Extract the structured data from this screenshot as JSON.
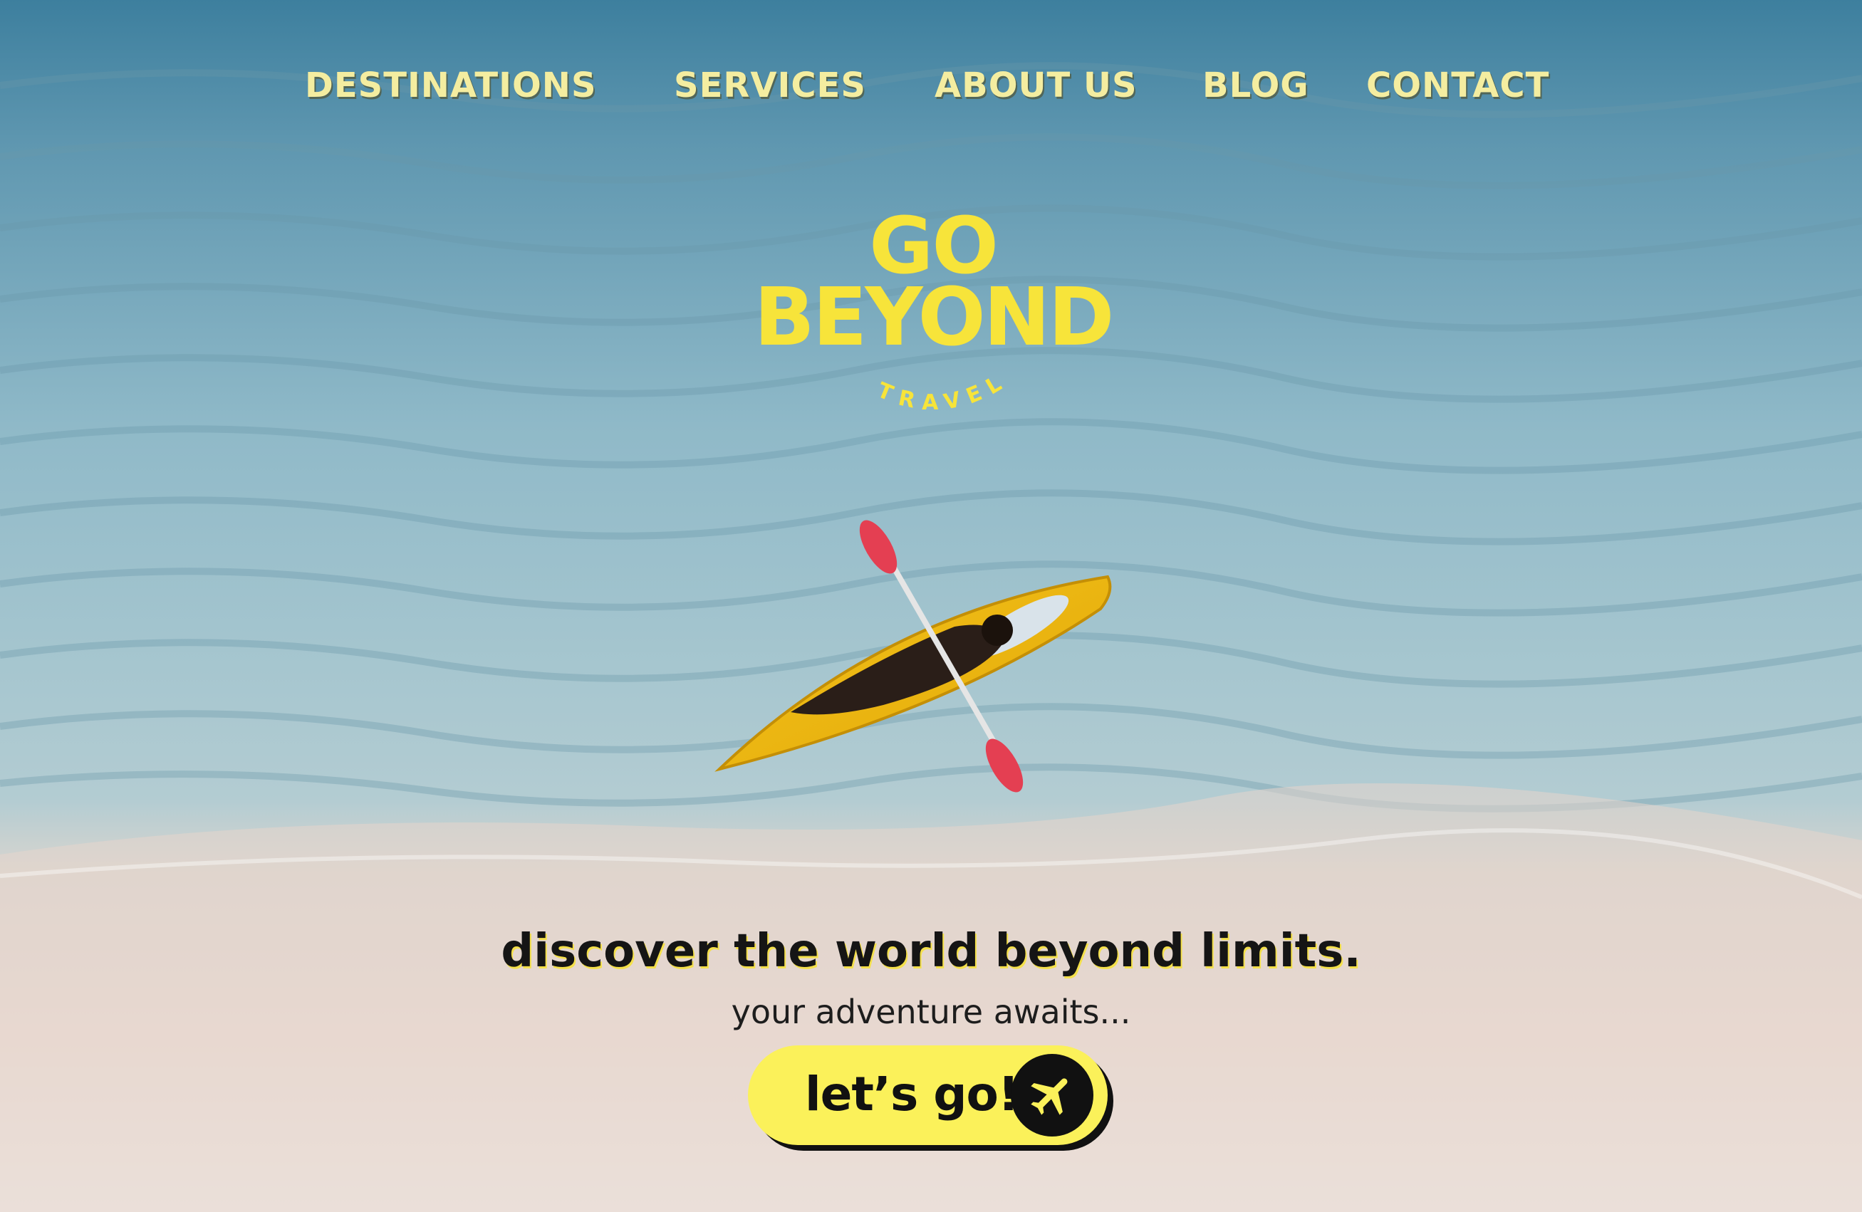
{
  "nav": {
    "items": [
      {
        "label": "DESTINATIONS"
      },
      {
        "label": "SERVICES"
      },
      {
        "label": "ABOUT US"
      },
      {
        "label": "BLOG"
      },
      {
        "label": "CONTACT"
      }
    ]
  },
  "logo": {
    "line1": "GO",
    "line2": "BEYOND",
    "tagline": "TRAVEL"
  },
  "hero": {
    "headline": "discover the world beyond limits.",
    "subheadline": "your adventure awaits...",
    "cta_label": "let’s go!",
    "cta_icon": "airplane-icon"
  },
  "colors": {
    "brand_yellow": "#f7e43a",
    "nav_text": "#f4eda0",
    "button_bg": "#fbf15a",
    "dark": "#111111"
  }
}
